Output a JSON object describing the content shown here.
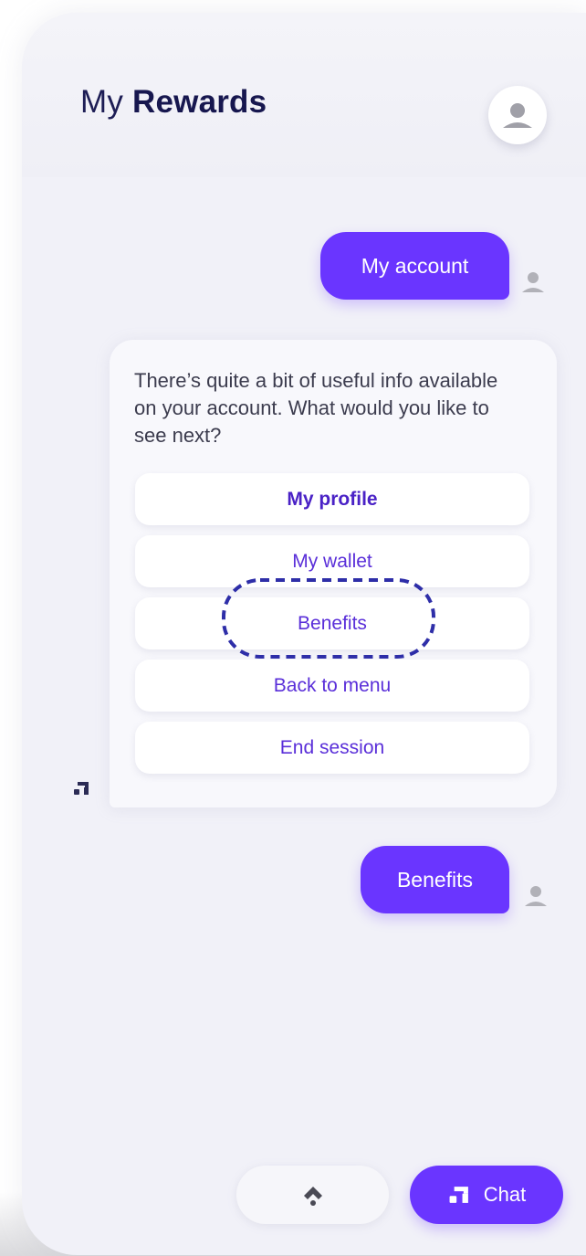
{
  "header": {
    "title_prefix": "My",
    "title_bold": "Rewards",
    "profile_icon": "person-icon"
  },
  "conversation": {
    "user_message_1": "My account",
    "bot_message": "There’s quite a bit of useful info available on your account. What would you like to see next?",
    "options": [
      {
        "label": "My profile"
      },
      {
        "label": "My wallet"
      },
      {
        "label": "Benefits"
      },
      {
        "label": "Back to menu"
      },
      {
        "label": "End session"
      }
    ],
    "highlighted_option": "Benefits",
    "user_message_2": "Benefits"
  },
  "footer": {
    "scroll_top_icon": "chevron-up-icon",
    "chat_label": "Chat",
    "chat_icon": "chat-logo-icon"
  },
  "colors": {
    "accent": "#6a35ff",
    "title": "#1d1d55",
    "option_text": "#5a2fd9",
    "highlight_ring": "#2e2ea8"
  }
}
